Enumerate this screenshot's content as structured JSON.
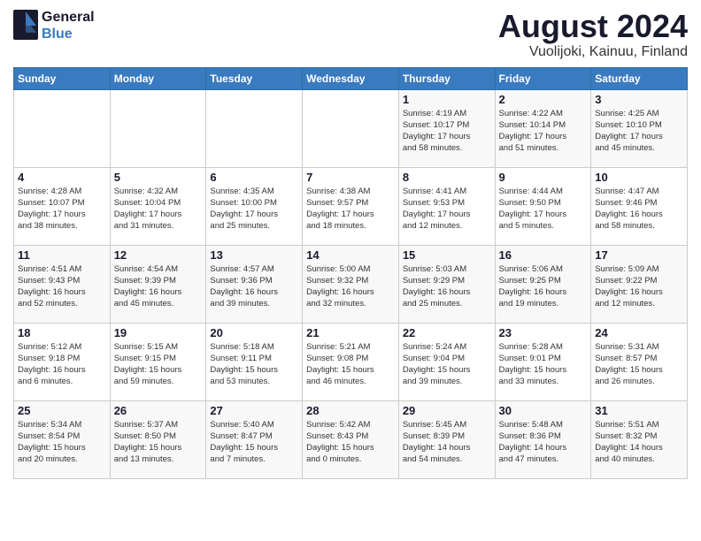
{
  "header": {
    "logo_general": "General",
    "logo_blue": "Blue",
    "month_year": "August 2024",
    "location": "Vuolijoki, Kainuu, Finland"
  },
  "weekdays": [
    "Sunday",
    "Monday",
    "Tuesday",
    "Wednesday",
    "Thursday",
    "Friday",
    "Saturday"
  ],
  "weeks": [
    [
      {
        "day": "",
        "info": ""
      },
      {
        "day": "",
        "info": ""
      },
      {
        "day": "",
        "info": ""
      },
      {
        "day": "",
        "info": ""
      },
      {
        "day": "1",
        "info": "Sunrise: 4:19 AM\nSunset: 10:17 PM\nDaylight: 17 hours\nand 58 minutes."
      },
      {
        "day": "2",
        "info": "Sunrise: 4:22 AM\nSunset: 10:14 PM\nDaylight: 17 hours\nand 51 minutes."
      },
      {
        "day": "3",
        "info": "Sunrise: 4:25 AM\nSunset: 10:10 PM\nDaylight: 17 hours\nand 45 minutes."
      }
    ],
    [
      {
        "day": "4",
        "info": "Sunrise: 4:28 AM\nSunset: 10:07 PM\nDaylight: 17 hours\nand 38 minutes."
      },
      {
        "day": "5",
        "info": "Sunrise: 4:32 AM\nSunset: 10:04 PM\nDaylight: 17 hours\nand 31 minutes."
      },
      {
        "day": "6",
        "info": "Sunrise: 4:35 AM\nSunset: 10:00 PM\nDaylight: 17 hours\nand 25 minutes."
      },
      {
        "day": "7",
        "info": "Sunrise: 4:38 AM\nSunset: 9:57 PM\nDaylight: 17 hours\nand 18 minutes."
      },
      {
        "day": "8",
        "info": "Sunrise: 4:41 AM\nSunset: 9:53 PM\nDaylight: 17 hours\nand 12 minutes."
      },
      {
        "day": "9",
        "info": "Sunrise: 4:44 AM\nSunset: 9:50 PM\nDaylight: 17 hours\nand 5 minutes."
      },
      {
        "day": "10",
        "info": "Sunrise: 4:47 AM\nSunset: 9:46 PM\nDaylight: 16 hours\nand 58 minutes."
      }
    ],
    [
      {
        "day": "11",
        "info": "Sunrise: 4:51 AM\nSunset: 9:43 PM\nDaylight: 16 hours\nand 52 minutes."
      },
      {
        "day": "12",
        "info": "Sunrise: 4:54 AM\nSunset: 9:39 PM\nDaylight: 16 hours\nand 45 minutes."
      },
      {
        "day": "13",
        "info": "Sunrise: 4:57 AM\nSunset: 9:36 PM\nDaylight: 16 hours\nand 39 minutes."
      },
      {
        "day": "14",
        "info": "Sunrise: 5:00 AM\nSunset: 9:32 PM\nDaylight: 16 hours\nand 32 minutes."
      },
      {
        "day": "15",
        "info": "Sunrise: 5:03 AM\nSunset: 9:29 PM\nDaylight: 16 hours\nand 25 minutes."
      },
      {
        "day": "16",
        "info": "Sunrise: 5:06 AM\nSunset: 9:25 PM\nDaylight: 16 hours\nand 19 minutes."
      },
      {
        "day": "17",
        "info": "Sunrise: 5:09 AM\nSunset: 9:22 PM\nDaylight: 16 hours\nand 12 minutes."
      }
    ],
    [
      {
        "day": "18",
        "info": "Sunrise: 5:12 AM\nSunset: 9:18 PM\nDaylight: 16 hours\nand 6 minutes."
      },
      {
        "day": "19",
        "info": "Sunrise: 5:15 AM\nSunset: 9:15 PM\nDaylight: 15 hours\nand 59 minutes."
      },
      {
        "day": "20",
        "info": "Sunrise: 5:18 AM\nSunset: 9:11 PM\nDaylight: 15 hours\nand 53 minutes."
      },
      {
        "day": "21",
        "info": "Sunrise: 5:21 AM\nSunset: 9:08 PM\nDaylight: 15 hours\nand 46 minutes."
      },
      {
        "day": "22",
        "info": "Sunrise: 5:24 AM\nSunset: 9:04 PM\nDaylight: 15 hours\nand 39 minutes."
      },
      {
        "day": "23",
        "info": "Sunrise: 5:28 AM\nSunset: 9:01 PM\nDaylight: 15 hours\nand 33 minutes."
      },
      {
        "day": "24",
        "info": "Sunrise: 5:31 AM\nSunset: 8:57 PM\nDaylight: 15 hours\nand 26 minutes."
      }
    ],
    [
      {
        "day": "25",
        "info": "Sunrise: 5:34 AM\nSunset: 8:54 PM\nDaylight: 15 hours\nand 20 minutes."
      },
      {
        "day": "26",
        "info": "Sunrise: 5:37 AM\nSunset: 8:50 PM\nDaylight: 15 hours\nand 13 minutes."
      },
      {
        "day": "27",
        "info": "Sunrise: 5:40 AM\nSunset: 8:47 PM\nDaylight: 15 hours\nand 7 minutes."
      },
      {
        "day": "28",
        "info": "Sunrise: 5:42 AM\nSunset: 8:43 PM\nDaylight: 15 hours\nand 0 minutes."
      },
      {
        "day": "29",
        "info": "Sunrise: 5:45 AM\nSunset: 8:39 PM\nDaylight: 14 hours\nand 54 minutes."
      },
      {
        "day": "30",
        "info": "Sunrise: 5:48 AM\nSunset: 8:36 PM\nDaylight: 14 hours\nand 47 minutes."
      },
      {
        "day": "31",
        "info": "Sunrise: 5:51 AM\nSunset: 8:32 PM\nDaylight: 14 hours\nand 40 minutes."
      }
    ]
  ]
}
